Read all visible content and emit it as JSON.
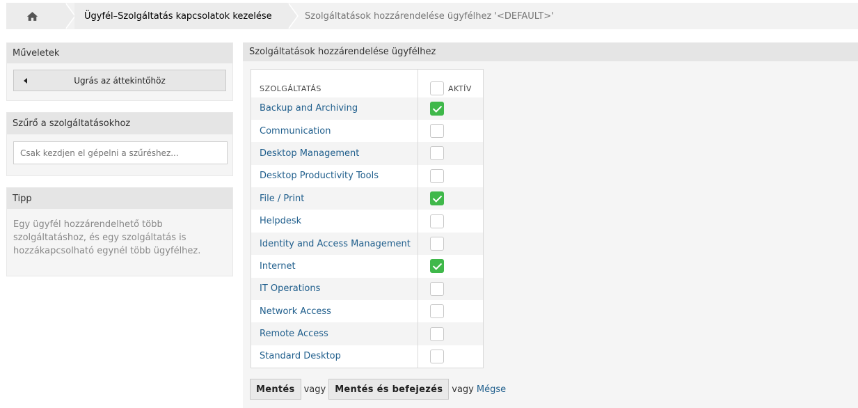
{
  "breadcrumb": {
    "home_icon": "home-icon",
    "management": "Ügyfél–Szolgáltatás kapcsolatok kezelése",
    "current": "Szolgáltatások hozzárendelése ügyfélhez '<DEFAULT>'"
  },
  "sidebar": {
    "actions": {
      "title": "Műveletek",
      "back_button": "Ugrás az áttekintőhöz"
    },
    "filter": {
      "title": "Szűrő a szolgáltatásokhoz",
      "placeholder": "Csak kezdjen el gépelni a szűréshez..."
    },
    "tip": {
      "title": "Tipp",
      "text": "Egy ügyfél hozzárendelhető több szolgáltatáshoz, és egy szolgáltatás is hozzákapcsolható egynél több ügyfélhez."
    }
  },
  "main": {
    "title": "Szolgáltatások hozzárendelése ügyfélhez",
    "table": {
      "col_service": "SZOLGÁLTATÁS",
      "col_active": "AKTÍV",
      "rows": [
        {
          "name": "Backup and Archiving",
          "active": true
        },
        {
          "name": "Communication",
          "active": false
        },
        {
          "name": "Desktop Management",
          "active": false
        },
        {
          "name": "Desktop Productivity Tools",
          "active": false
        },
        {
          "name": "File / Print",
          "active": true
        },
        {
          "name": "Helpdesk",
          "active": false
        },
        {
          "name": "Identity and Access Management",
          "active": false
        },
        {
          "name": "Internet",
          "active": true
        },
        {
          "name": "IT Operations",
          "active": false
        },
        {
          "name": "Network Access",
          "active": false
        },
        {
          "name": "Remote Access",
          "active": false
        },
        {
          "name": "Standard Desktop",
          "active": false
        }
      ]
    },
    "actions": {
      "save": "Mentés",
      "or1": "vagy",
      "save_finish": "Mentés és befejezés",
      "or2": "vagy",
      "cancel": "Mégse"
    }
  }
}
